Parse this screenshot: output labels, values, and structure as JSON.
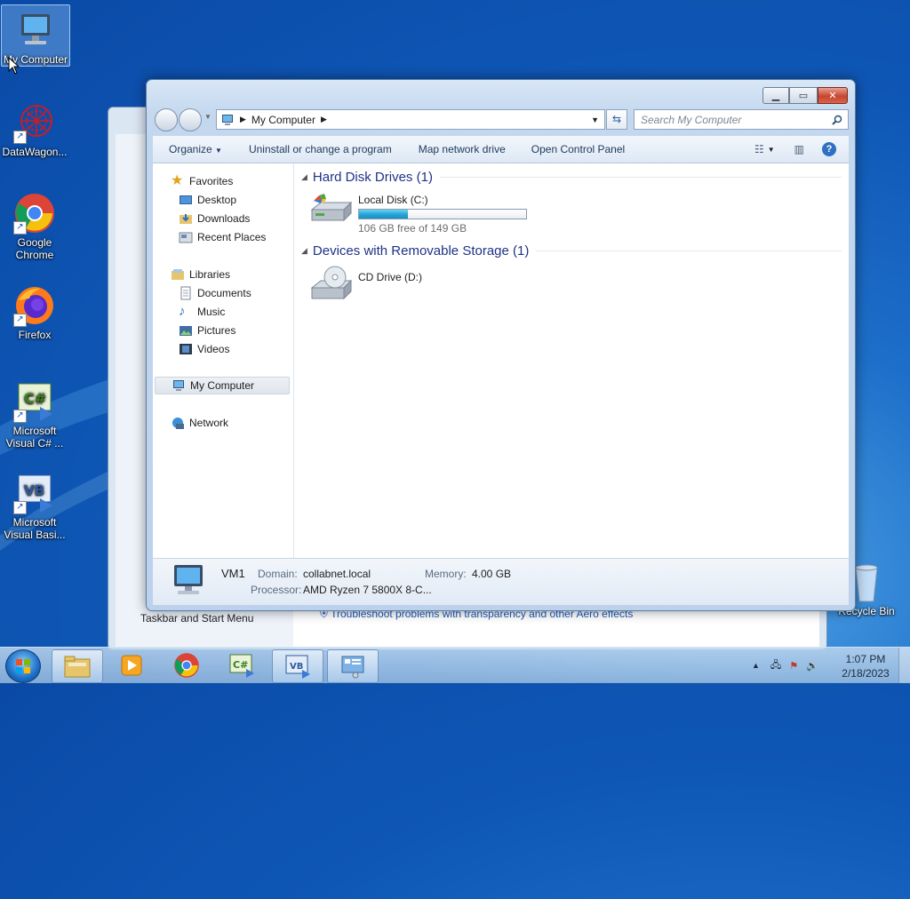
{
  "desktop": {
    "icons": [
      {
        "label": "My Computer"
      },
      {
        "label": "DataWagon..."
      },
      {
        "label": "Google Chrome"
      },
      {
        "label": "Firefox"
      },
      {
        "label": "Microsoft Visual C# ..."
      },
      {
        "label": "Microsoft Visual Basi..."
      },
      {
        "label": "Recycle Bin"
      }
    ]
  },
  "background_window": {
    "link1": "Taskbar and Start Menu",
    "link2": "Troubleshoot problems with transparency and other Aero effects"
  },
  "explorer": {
    "breadcrumb": "My Computer",
    "search_placeholder": "Search My Computer",
    "toolbar": {
      "organize": "Organize",
      "uninstall": "Uninstall or change a program",
      "map_drive": "Map network drive",
      "control_panel": "Open Control Panel"
    },
    "nav": {
      "favorites": "Favorites",
      "desktop": "Desktop",
      "downloads": "Downloads",
      "recent": "Recent Places",
      "libraries": "Libraries",
      "documents": "Documents",
      "music": "Music",
      "pictures": "Pictures",
      "videos": "Videos",
      "computer": "My Computer",
      "network": "Network"
    },
    "groups": {
      "hdd": "Hard Disk Drives (1)",
      "removable": "Devices with Removable Storage (1)"
    },
    "drives": {
      "c_name": "Local Disk (C:)",
      "c_free": "106 GB free of 149 GB",
      "c_used_fraction": 0.29,
      "d_name": "CD Drive (D:)"
    },
    "details": {
      "name": "VM1",
      "domain_label": "Domain:",
      "domain": "collabnet.local",
      "memory_label": "Memory:",
      "memory": "4.00 GB",
      "processor_label": "Processor:",
      "processor": "AMD Ryzen 7 5800X 8-C..."
    }
  },
  "taskbar": {
    "time": "1:07 PM",
    "date": "2/18/2023"
  }
}
